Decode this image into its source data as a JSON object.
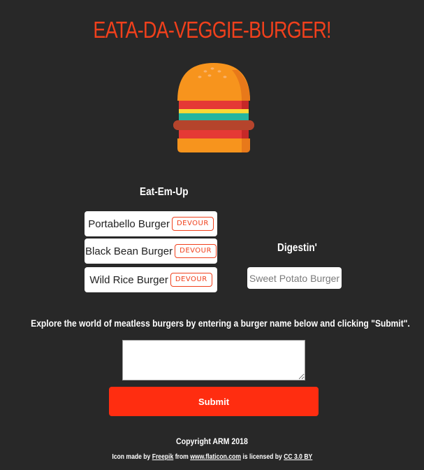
{
  "header": {
    "title": "EATA-DA-VEGGIE-BURGER!",
    "logo_icon": "burger-icon"
  },
  "eat_column": {
    "heading": "Eat-Em-Up",
    "items": [
      {
        "name": "Portabello Burger",
        "button_label": "DEVOUR"
      },
      {
        "name": "Black Bean Burger",
        "button_label": "DEVOUR"
      },
      {
        "name": "Wild Rice Burger",
        "button_label": "DEVOUR"
      }
    ]
  },
  "digest_column": {
    "heading": "Digestin'",
    "items": [
      {
        "name": "Sweet Potato Burger"
      }
    ]
  },
  "form": {
    "instructions": "Explore the world of meatless burgers by entering a burger name below and clicking \"Submit\".",
    "input_value": "",
    "submit_label": "Submit"
  },
  "footer": {
    "copyright": "Copyright ARM 2018",
    "attribution": {
      "prefix": "Icon made by",
      "author_link": "Freepik",
      "from_text": "from",
      "site_link": "www.flaticon.com",
      "licensed_text": "is licensed by",
      "license_link": "CC 3.0 BY"
    }
  },
  "colors": {
    "background": "#282828",
    "accent": "#f0401c",
    "submit": "#ff2d10",
    "card": "#ffffff"
  }
}
